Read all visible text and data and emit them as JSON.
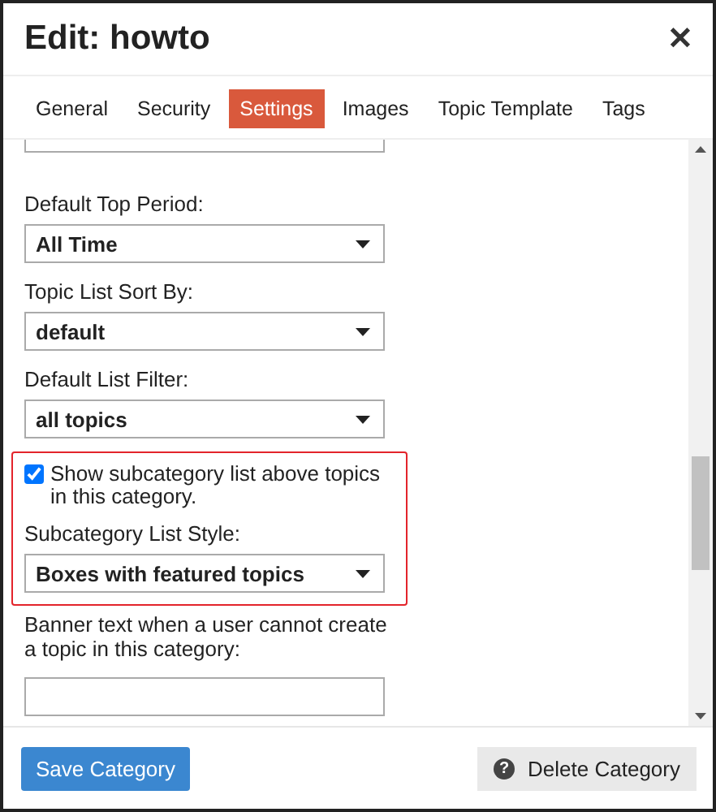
{
  "dialog": {
    "title": "Edit: howto",
    "close": "✕"
  },
  "tabs": [
    {
      "label": "General",
      "selected": false
    },
    {
      "label": "Security",
      "selected": false
    },
    {
      "label": "Settings",
      "selected": true
    },
    {
      "label": "Images",
      "selected": false
    },
    {
      "label": "Topic Template",
      "selected": false
    },
    {
      "label": "Tags",
      "selected": false
    }
  ],
  "fields": [
    {
      "kind": "select",
      "label": "Default Top Period:",
      "value": "All Time"
    },
    {
      "kind": "select",
      "label": "Topic List Sort By:",
      "value": "default"
    },
    {
      "kind": "select",
      "label": "Default List Filter:",
      "value": "all topics"
    }
  ],
  "highlighted_group": {
    "highlighted": true,
    "checkbox": {
      "label": "Show subcategory list above topics in this category.",
      "checked": true
    },
    "select": {
      "label": "Subcategory List Style:",
      "value": "Boxes with featured topics"
    }
  },
  "banner_field": {
    "label": "Banner text when a user cannot create a topic in this category:"
  },
  "footer": {
    "save": "Save Category",
    "delete": "Delete Category",
    "delete_icon": "?"
  }
}
